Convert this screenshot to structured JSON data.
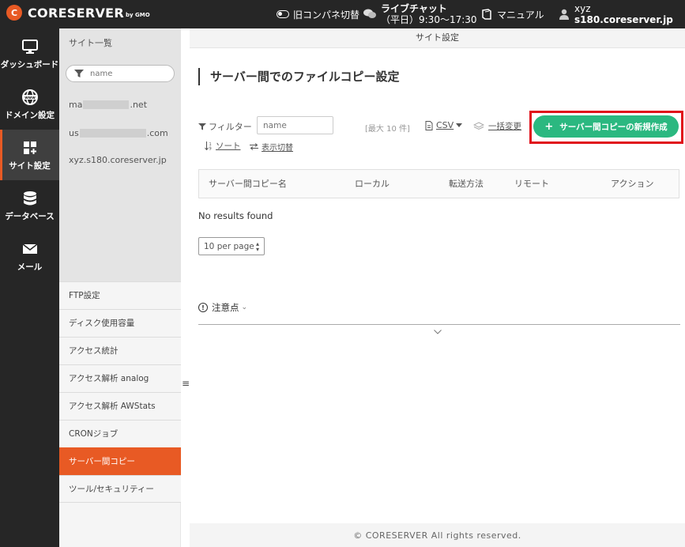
{
  "topbar": {
    "logo_mark": "C",
    "logo_text": "CORESERVER",
    "logo_sub": "by GMO",
    "old_panel_label": "旧コンパネ切替",
    "live_chat_title": "ライブチャット",
    "live_chat_hours": "（平日）9:30〜17:30",
    "manual_label": "マニュアル",
    "user_name": "xyz",
    "user_server": "s180.coreserver.jp"
  },
  "leftnav": {
    "items": [
      {
        "label": "ダッシュボード",
        "icon": "monitor-icon"
      },
      {
        "label": "ドメイン設定",
        "icon": "globe-icon"
      },
      {
        "label": "サイト設定",
        "icon": "grid-plus-icon"
      },
      {
        "label": "データベース",
        "icon": "database-icon"
      },
      {
        "label": "メール",
        "icon": "mail-icon"
      }
    ],
    "active_index": 2
  },
  "sitepanel": {
    "title": "サイト一覧",
    "search_placeholder": "name",
    "sites": [
      {
        "prefix": "ma",
        "suffix": ".net"
      },
      {
        "prefix": "us",
        "suffix": ".com"
      },
      {
        "prefix": "xyz.s180.coreserver.jp",
        "suffix": ""
      }
    ],
    "menu": [
      "FTP設定",
      "ディスク使用容量",
      "アクセス統計",
      "アクセス解析 analog",
      "アクセス解析 AWStats",
      "CRONジョブ",
      "サーバー間コピー",
      "ツール/セキュリティー"
    ],
    "active_menu_index": 6,
    "collapse_glyph": "≡"
  },
  "main": {
    "header": "サイト設定",
    "page_title": "サーバー間でのファイルコピー設定",
    "filter_label": "フィルター",
    "filter_placeholder": "name",
    "max_count": "[最大 10 件]",
    "csv_label": "CSV",
    "bulk_change_label": "一括変更",
    "new_button_label": "サーバー間コピーの新規作成",
    "sort_label": "ソート",
    "display_toggle_label": "表示切替",
    "columns": [
      "サーバー間コピー名",
      "ローカル",
      "転送方法",
      "リモート",
      "アクション"
    ],
    "no_results": "No results found",
    "per_page": "10 per page",
    "notes_label": "注意点",
    "footer": "© CORESERVER All rights reserved."
  },
  "colors": {
    "accent": "#e85a24",
    "primary_button": "#2bb880",
    "highlight": "#e0101a",
    "topbar": "#262626"
  }
}
